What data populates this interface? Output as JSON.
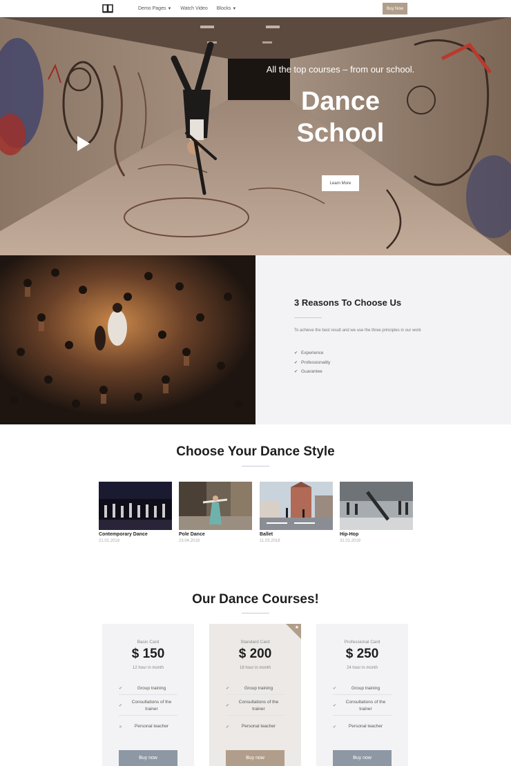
{
  "nav": {
    "links": [
      {
        "label": "Demo Pages",
        "dropdown": true
      },
      {
        "label": "Watch Video",
        "dropdown": false
      },
      {
        "label": "Blocks",
        "dropdown": true
      }
    ],
    "buy_now": "Buy Now"
  },
  "hero": {
    "subtitle": "All the top courses – from our school.",
    "title_line1": "Dance",
    "title_line2": "School",
    "cta": "Learn More"
  },
  "reasons": {
    "title": "3 Reasons To Choose Us",
    "description": "To achieve the best result and we use the three principles in our work",
    "items": [
      "Experience",
      "Professionality",
      "Guarantee"
    ]
  },
  "styles": {
    "title": "Choose Your Dance Style",
    "items": [
      {
        "name": "Contemporary Dance",
        "date": "21.01.2018"
      },
      {
        "name": "Pole Dance",
        "date": "23.04.2018"
      },
      {
        "name": "Ballet",
        "date": "11.03.2018"
      },
      {
        "name": "Hip-Hop",
        "date": "31.01.2018"
      }
    ]
  },
  "courses": {
    "title": "Our Dance Courses!",
    "cards": [
      {
        "label": "Basic Card",
        "price": "$ 150",
        "period": "12 hour in month",
        "features": [
          {
            "text": "Group training",
            "included": true
          },
          {
            "text": "Consultations of the trainer",
            "included": true
          },
          {
            "text": "Personal teacher",
            "included": false
          }
        ],
        "button": "Buy now"
      },
      {
        "label": "Standard Card",
        "price": "$ 200",
        "period": "18 hour in month",
        "features": [
          {
            "text": "Group training",
            "included": true
          },
          {
            "text": "Consultations of the trainer",
            "included": true
          },
          {
            "text": "Personal teacher",
            "included": true
          }
        ],
        "button": "Buy now"
      },
      {
        "label": "Professional Card",
        "price": "$ 250",
        "period": "24 hour in month",
        "features": [
          {
            "text": "Group training",
            "included": true
          },
          {
            "text": "Consultations of the trainer",
            "included": true
          },
          {
            "text": "Personal teacher",
            "included": true
          }
        ],
        "button": "Buy now"
      }
    ]
  },
  "colors": {
    "accent": "#b19e8a",
    "button_grey": "#8d98a4",
    "panel_bg": "#f3f3f5"
  },
  "icons": {
    "logo": "open-book-icon",
    "play": "play-icon",
    "check": "check-icon",
    "cross": "cross-icon",
    "star": "star-icon"
  }
}
